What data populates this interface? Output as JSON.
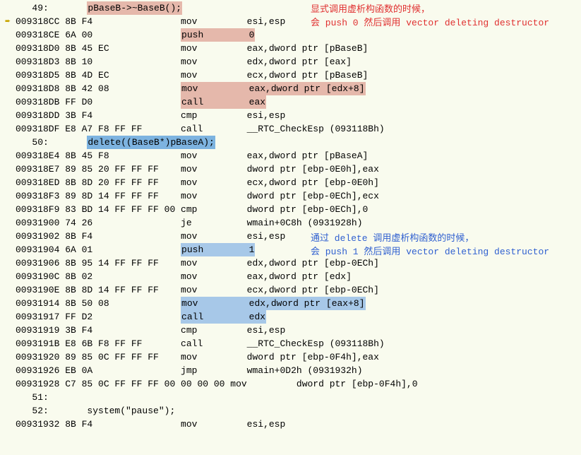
{
  "comments": {
    "red1": "显式调用虚析构函数的时候，",
    "red2": "会 push 0 然后调用 vector deleting destructor",
    "blue1": "通过 delete 调用虚析构函数的时候，",
    "blue2": "会 push 1 然后调用 vector deleting destructor"
  },
  "lines": [
    {
      "gutter": "",
      "text": "   49:       ",
      "src": "pBaseB->~BaseB();",
      "srchl": "pink"
    },
    {
      "gutter": "arrow",
      "addr": "009318CC ",
      "bytes": "8B F4                ",
      "mnem": "mov         ",
      "ops": "esi,esp"
    },
    {
      "gutter": "",
      "addr": "009318CE ",
      "bytes": "6A 00                ",
      "mnemhl": "pink",
      "mnem": "push        ",
      "opshl": "pink",
      "ops": "0"
    },
    {
      "gutter": "",
      "addr": "009318D0 ",
      "bytes": "8B 45 EC             ",
      "mnem": "mov         ",
      "ops": "eax,dword ptr [pBaseB]"
    },
    {
      "gutter": "",
      "addr": "009318D3 ",
      "bytes": "8B 10                ",
      "mnem": "mov         ",
      "ops": "edx,dword ptr [eax]"
    },
    {
      "gutter": "",
      "addr": "009318D5 ",
      "bytes": "8B 4D EC             ",
      "mnem": "mov         ",
      "ops": "ecx,dword ptr [pBaseB]"
    },
    {
      "gutter": "",
      "addr": "009318D8 ",
      "bytes": "8B 42 08             ",
      "mnemhl": "pink",
      "mnem": "mov         ",
      "opshl": "pink",
      "ops": "eax,dword ptr [edx+8]"
    },
    {
      "gutter": "",
      "addr": "009318DB ",
      "bytes": "FF D0                ",
      "mnemhl": "pink",
      "mnem": "call        ",
      "opshl": "pink",
      "ops": "eax"
    },
    {
      "gutter": "",
      "addr": "009318DD ",
      "bytes": "3B F4                ",
      "mnem": "cmp         ",
      "ops": "esi,esp"
    },
    {
      "gutter": "",
      "addr": "009318DF ",
      "bytes": "E8 A7 F8 FF FF       ",
      "mnem": "call        ",
      "ops": "__RTC_CheckEsp (093118Bh)"
    },
    {
      "gutter": "",
      "text": "   50:       ",
      "src": "delete((BaseB*)pBaseA);",
      "srchl": "blue"
    },
    {
      "gutter": "",
      "addr": "009318E4 ",
      "bytes": "8B 45 F8             ",
      "mnem": "mov         ",
      "ops": "eax,dword ptr [pBaseA]"
    },
    {
      "gutter": "",
      "addr": "009318E7 ",
      "bytes": "89 85 20 FF FF FF    ",
      "mnem": "mov         ",
      "ops": "dword ptr [ebp-0E0h],eax"
    },
    {
      "gutter": "",
      "addr": "009318ED ",
      "bytes": "8B 8D 20 FF FF FF    ",
      "mnem": "mov         ",
      "ops": "ecx,dword ptr [ebp-0E0h]"
    },
    {
      "gutter": "",
      "addr": "009318F3 ",
      "bytes": "89 8D 14 FF FF FF    ",
      "mnem": "mov         ",
      "ops": "dword ptr [ebp-0ECh],ecx"
    },
    {
      "gutter": "",
      "addr": "009318F9 ",
      "bytes": "83 BD 14 FF FF FF 00 ",
      "mnem": "cmp         ",
      "ops": "dword ptr [ebp-0ECh],0"
    },
    {
      "gutter": "",
      "addr": "00931900 ",
      "bytes": "74 26                ",
      "mnem": "je          ",
      "ops": "wmain+0C8h (0931928h)"
    },
    {
      "gutter": "",
      "addr": "00931902 ",
      "bytes": "8B F4                ",
      "mnem": "mov         ",
      "ops": "esi,esp"
    },
    {
      "gutter": "",
      "addr": "00931904 ",
      "bytes": "6A 01                ",
      "mnemhl": "grayblue",
      "mnem": "push        ",
      "opshl": "grayblue",
      "ops": "1"
    },
    {
      "gutter": "",
      "addr": "00931906 ",
      "bytes": "8B 95 14 FF FF FF    ",
      "mnem": "mov         ",
      "ops": "edx,dword ptr [ebp-0ECh]"
    },
    {
      "gutter": "",
      "addr": "0093190C ",
      "bytes": "8B 02                ",
      "mnem": "mov         ",
      "ops": "eax,dword ptr [edx]"
    },
    {
      "gutter": "",
      "addr": "0093190E ",
      "bytes": "8B 8D 14 FF FF FF    ",
      "mnem": "mov         ",
      "ops": "ecx,dword ptr [ebp-0ECh]"
    },
    {
      "gutter": "",
      "addr": "00931914 ",
      "bytes": "8B 50 08             ",
      "mnemhl": "grayblue",
      "mnem": "mov         ",
      "opshl": "grayblue",
      "ops": "edx,dword ptr [eax+8]"
    },
    {
      "gutter": "",
      "addr": "00931917 ",
      "bytes": "FF D2                ",
      "mnemhl": "grayblue",
      "mnem": "call        ",
      "opshl": "grayblue",
      "ops": "edx"
    },
    {
      "gutter": "",
      "addr": "00931919 ",
      "bytes": "3B F4                ",
      "mnem": "cmp         ",
      "ops": "esi,esp"
    },
    {
      "gutter": "",
      "addr": "0093191B ",
      "bytes": "E8 6B F8 FF FF       ",
      "mnem": "call        ",
      "ops": "__RTC_CheckEsp (093118Bh)"
    },
    {
      "gutter": "",
      "addr": "00931920 ",
      "bytes": "89 85 0C FF FF FF    ",
      "mnem": "mov         ",
      "ops": "dword ptr [ebp-0F4h],eax"
    },
    {
      "gutter": "",
      "addr": "00931926 ",
      "bytes": "EB 0A                ",
      "mnem": "jmp         ",
      "ops": "wmain+0D2h (0931932h)"
    },
    {
      "gutter": "",
      "addr": "00931928 ",
      "bytes": "C7 85 0C FF FF FF 00 00 00 00 ",
      "mnem": "mov         ",
      "ops": "dword ptr [ebp-0F4h],0"
    },
    {
      "gutter": "",
      "text": "   51:",
      "src": ""
    },
    {
      "gutter": "",
      "text": "   52:       ",
      "src": "system(\"pause\");",
      "srchl": ""
    },
    {
      "gutter": "",
      "addr": "00931932 ",
      "bytes": "8B F4                ",
      "mnem": "mov         ",
      "ops": "esi,esp"
    }
  ]
}
